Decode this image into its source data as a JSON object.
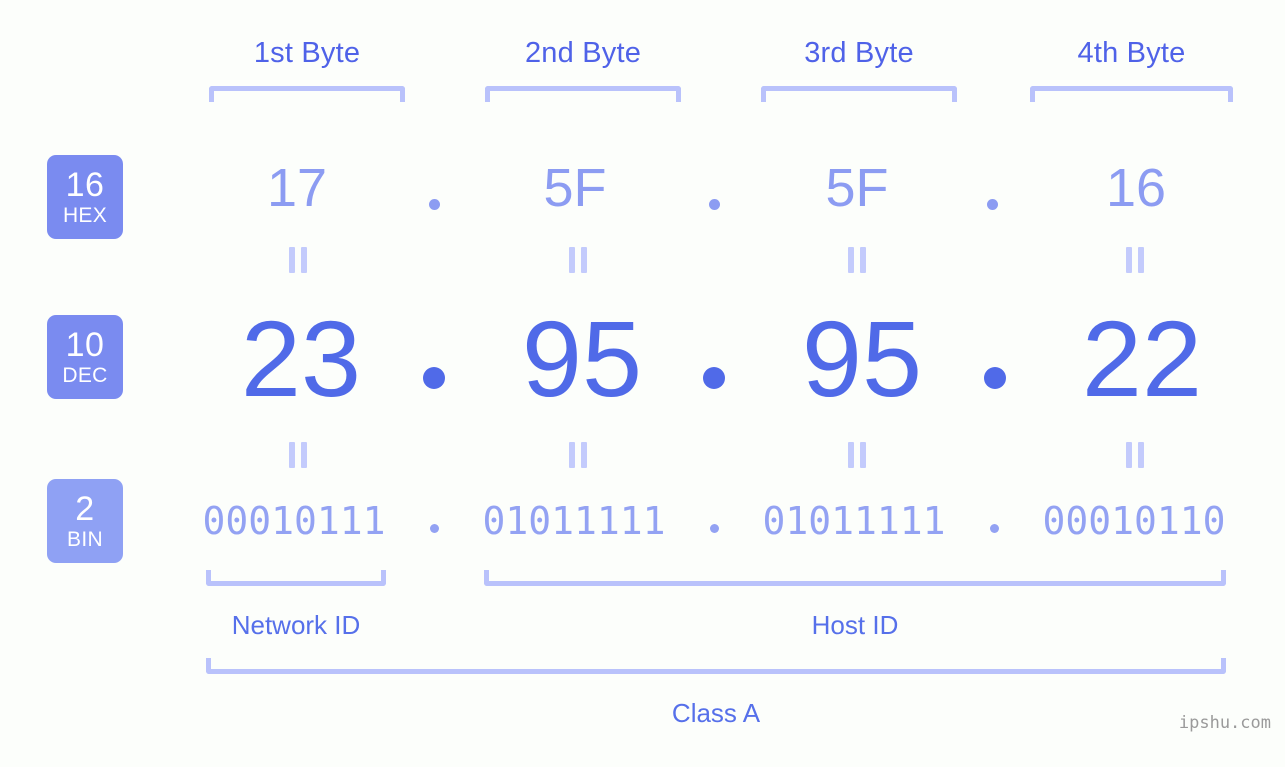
{
  "background_color": "#fcfefb",
  "accent_colors": {
    "header_text": "#4f62e8",
    "bracket": "#b9c2fb",
    "badge": "#7a8bf0",
    "badge_light": "#8fa1f4",
    "hex_value": "#8c9cf2",
    "dec_value": "#506ae8",
    "bin_value": "#93a2f3",
    "equals_mark": "#c3cbfc",
    "section_label": "#5670ea",
    "watermark": "#9a9a9a"
  },
  "byte_headers": [
    {
      "label": "1st Byte"
    },
    {
      "label": "2nd Byte"
    },
    {
      "label": "3rd Byte"
    },
    {
      "label": "4th Byte"
    }
  ],
  "bases": [
    {
      "number": "16",
      "name": "HEX"
    },
    {
      "number": "10",
      "name": "DEC"
    },
    {
      "number": "2",
      "name": "BIN"
    }
  ],
  "rows": {
    "hex": {
      "octets": [
        "17",
        "5F",
        "5F",
        "16"
      ],
      "separator": "."
    },
    "dec": {
      "octets": [
        "23",
        "95",
        "95",
        "22"
      ],
      "separator": "."
    },
    "bin": {
      "octets": [
        "00010111",
        "01011111",
        "01011111",
        "00010110"
      ],
      "separator": "."
    }
  },
  "equality_marks": {
    "symbol": "=",
    "count_per_gap": 4
  },
  "sections": [
    {
      "label": "Network ID"
    },
    {
      "label": "Host ID"
    }
  ],
  "class_label": "Class A",
  "watermark": "ipshu.com"
}
